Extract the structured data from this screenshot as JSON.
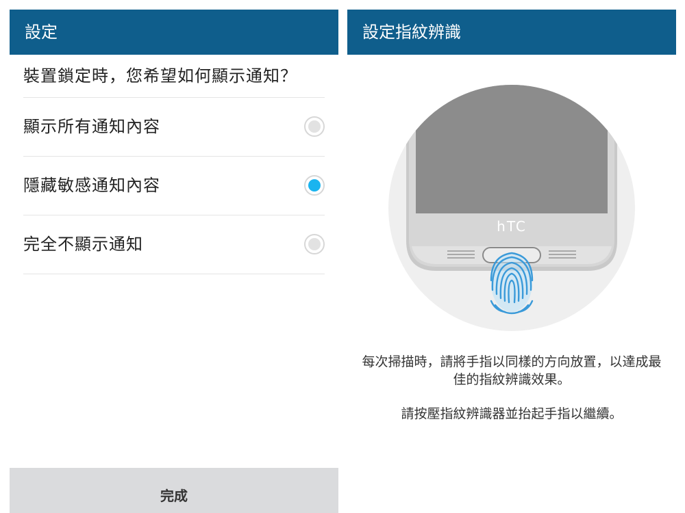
{
  "left_screen": {
    "title": "設定",
    "question": "裝置鎖定時，您希望如何顯示通知？",
    "options": [
      {
        "label": "顯示所有通知內容",
        "selected": false
      },
      {
        "label": "隱藏敏感通知內容",
        "selected": true
      },
      {
        "label": "完全不顯示通知",
        "selected": false
      }
    ],
    "done_label": "完成"
  },
  "right_screen": {
    "title": "設定指紋辨識",
    "phone_brand": "hTC",
    "instruction_line1": "每次掃描時，請將手指以同樣的方向放置，以達成最佳的指紋辨識效果。",
    "instruction_line2": "請按壓指紋辨識器並抬起手指以繼續。"
  },
  "colors": {
    "appbar": "#0f5e8c",
    "radio_selected": "#1ab4ef",
    "fingerprint": "#3a9ad9",
    "done_bar": "#dadbdd"
  },
  "icons": {
    "radio_unselected": "radio-unselected-icon",
    "radio_selected": "radio-selected-icon",
    "fingerprint": "fingerprint-icon"
  }
}
